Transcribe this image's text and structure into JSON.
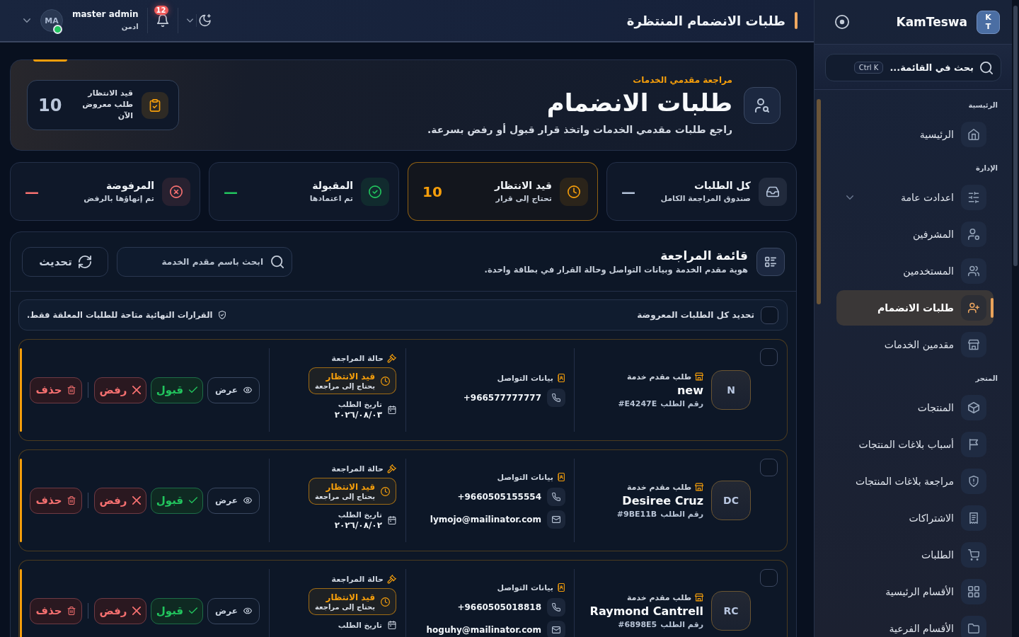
{
  "topbar": {
    "title": "طلبات الانضمام المنتظرة",
    "user": {
      "initials": "MA",
      "name": "master admin",
      "role": "ادمن",
      "online": true
    },
    "notifications": {
      "count": "12"
    }
  },
  "sidebar": {
    "brand": {
      "logo_lines": [
        "K",
        "T"
      ],
      "name": "KamTeswa"
    },
    "search": {
      "label": "بحث في القائمة...",
      "shortcut": "Ctrl K"
    },
    "sections": [
      {
        "title": "الرئيسية",
        "items": [
          {
            "label": "الرئيسية",
            "selected": false
          }
        ]
      },
      {
        "title": "الإدارة",
        "items": [
          {
            "label": "اعدادت عامة",
            "selected": false,
            "expanded": false
          },
          {
            "label": "المشرفين",
            "selected": false
          },
          {
            "label": "المستخدمين",
            "selected": false
          },
          {
            "label": "طلبات الانضمام",
            "selected": true
          },
          {
            "label": "مقدمين الخدمات",
            "selected": false
          }
        ]
      },
      {
        "title": "المتجر",
        "items": [
          {
            "label": "المنتجات",
            "selected": false
          },
          {
            "label": "أسباب بلاغات المنتجات",
            "selected": false
          },
          {
            "label": "مراجعة بلاغات المنتجات",
            "selected": false
          },
          {
            "label": "الاشتراكات",
            "selected": false
          },
          {
            "label": "الطلبات",
            "selected": false
          },
          {
            "label": "الأقسام الرئيسية",
            "selected": false
          },
          {
            "label": "الأقسام الفرعية",
            "selected": false
          }
        ]
      }
    ]
  },
  "hero": {
    "eyebrow": "مراجعة مقدمي الخدمات",
    "title": "طلبات الانضمام",
    "description": "راجع طلبات مقدمي الخدمات واتخذ قرار قبول أو رفض بسرعة.",
    "summary": {
      "label": "قيد الانتظار",
      "caption": "طلب معروض الآن",
      "value": "10"
    }
  },
  "stats": [
    {
      "title": "كل الطلبات",
      "subtitle": "صندوق المراجعة الكامل",
      "value": "—",
      "color": "#b4c3da",
      "selected": false
    },
    {
      "title": "قيد الانتظار",
      "subtitle": "تحتاج إلى قرار",
      "value": "10",
      "color": "#f59e0b",
      "selected": true
    },
    {
      "title": "المقبولة",
      "subtitle": "تم اعتمادها",
      "value": "—",
      "color": "#22c55e",
      "selected": false
    },
    {
      "title": "المرفوضة",
      "subtitle": "تم إنهاؤها بالرفض",
      "value": "—",
      "color": "#f87171",
      "selected": false
    }
  ],
  "review_list": {
    "title": "قائمة المراجعة",
    "subtitle": "هوية مقدم الخدمة وبيانات التواصل وحالة القرار في بطاقة واحدة.",
    "search": {
      "placeholder": "ابحث باسم مقدم الخدمة"
    },
    "refresh_label": "تحديث",
    "select_all": {
      "label": "تحديد كل الطلبات المعروضة",
      "checked": false
    },
    "notice": "القرارات النهائية متاحة للطلبات المعلقة فقط.",
    "rows": [
      {
        "selected": false,
        "initials": "N",
        "type_label": "طلب مقدم خدمة",
        "name": "new",
        "request_label": "رقم الطلب",
        "request_id": "#E4247E",
        "contact_label": "بيانات التواصل",
        "phone": "+966577777777",
        "status_label": "حالة المراجعة",
        "status": {
          "kind": "pending",
          "title": "قيد الانتظار",
          "note": "يحتاج إلى مراجعة"
        },
        "date_label": "تاريخ الطلب",
        "date": "٢٠٢٦/٠٨/٠٣",
        "actions": [
          {
            "kind": "view",
            "label": "عرض"
          },
          {
            "kind": "accept",
            "label": "قبول"
          },
          {
            "kind": "reject",
            "label": "رفض"
          },
          {
            "kind": "delete",
            "label": "حذف"
          }
        ]
      },
      {
        "selected": false,
        "initials": "DC",
        "type_label": "طلب مقدم خدمة",
        "name": "Desiree Cruz",
        "request_label": "رقم الطلب",
        "request_id": "#9BE11B",
        "contact_label": "بيانات التواصل",
        "phone": "+9660505155554",
        "email": "lymojo@mailinator.com",
        "status_label": "حالة المراجعة",
        "status": {
          "kind": "pending",
          "title": "قيد الانتظار",
          "note": "يحتاج إلى مراجعة"
        },
        "date_label": "تاريخ الطلب",
        "date": "٢٠٢٦/٠٨/٠٢",
        "actions": [
          {
            "kind": "view",
            "label": "عرض"
          },
          {
            "kind": "accept",
            "label": "قبول"
          },
          {
            "kind": "reject",
            "label": "رفض"
          },
          {
            "kind": "delete",
            "label": "حذف"
          }
        ]
      },
      {
        "selected": false,
        "initials": "RC",
        "type_label": "طلب مقدم خدمة",
        "name": "Raymond Cantrell",
        "request_label": "رقم الطلب",
        "request_id": "#6898E5",
        "contact_label": "بيانات التواصل",
        "phone": "+9660505018818",
        "email": "hoguhy@mailinator.com",
        "status_label": "حالة المراجعة",
        "status": {
          "kind": "pending",
          "title": "قيد الانتظار",
          "note": "يحتاج إلى مراجعة"
        },
        "date_label": "تاريخ الطلب",
        "actions": [
          {
            "kind": "view",
            "label": "عرض"
          },
          {
            "kind": "accept",
            "label": "قبول"
          },
          {
            "kind": "reject",
            "label": "رفض"
          },
          {
            "kind": "delete",
            "label": "حذف"
          }
        ]
      }
    ]
  }
}
